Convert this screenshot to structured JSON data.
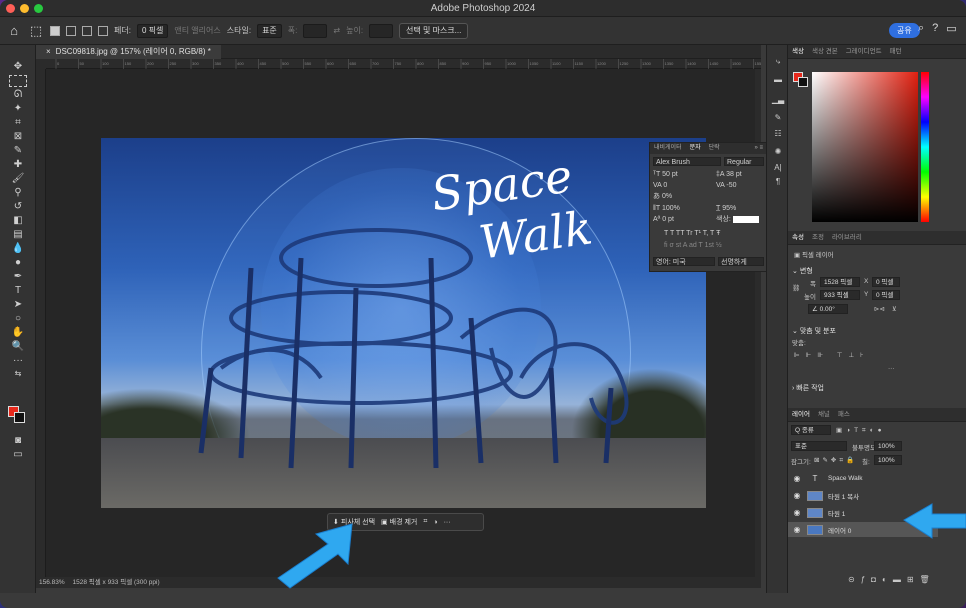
{
  "app": {
    "title": "Adobe Photoshop 2024",
    "share_label": "공유"
  },
  "options_bar": {
    "feather_label": "페더:",
    "feather_value": "0 픽셀",
    "antialias_label": "앤티 앨리어스",
    "style_label": "스타일:",
    "style_value": "표준",
    "width_label": "폭:",
    "height_label": "높이:",
    "select_mask_label": "선택 및 마스크..."
  },
  "document": {
    "tab_title": "DSC09818.jpg @ 157% (레이어 0, RGB/8) *",
    "zoom": "156.83%",
    "status_info": "1528 픽셀 x 933 픽셀 (300 ppi)",
    "ruler_ticks": [
      "0",
      "50",
      "100",
      "150",
      "200",
      "250",
      "300",
      "350",
      "400",
      "450",
      "500",
      "550",
      "600",
      "650",
      "700",
      "750",
      "800",
      "850",
      "900",
      "950",
      "1000",
      "1050",
      "1100",
      "1150",
      "1200",
      "1250",
      "1300",
      "1350",
      "1400",
      "1450",
      "1500",
      "1550"
    ]
  },
  "artwork": {
    "line1": "Space",
    "line2": "Walk"
  },
  "context_bar": {
    "select_subject": "피사체 선택",
    "remove_bg": "배경 제거",
    "more": "···"
  },
  "character_panel": {
    "tabs": [
      "내비게이터",
      "문자",
      "단락"
    ],
    "active_tab": "문자",
    "font_family": "Alex Brush",
    "font_style": "Regular",
    "font_size": "50 pt",
    "leading": "38 pt",
    "kerning": "0",
    "tracking": "-50",
    "tsume": "0%",
    "vertical_scale": "100%",
    "horizontal_scale": "95%",
    "baseline": "0 pt",
    "color_label": "색상:",
    "language": "영어: 미국",
    "antialias": "선명하게",
    "type_buttons": "T  T  TT  Tr  T¹  T,  T  Ŧ",
    "ot_buttons": "fi  σ  st  A  ad  T  1st  ½"
  },
  "color_panel": {
    "tabs": [
      "색상",
      "색상 견본",
      "그레이디언트",
      "패턴"
    ],
    "active_tab": "색상",
    "fg_color": "#e8291c"
  },
  "properties_panel": {
    "tabs": [
      "속성",
      "조정",
      "라이브러리"
    ],
    "active_tab": "속성",
    "layer_kind": "픽셀 레이어",
    "transform_title": "변형",
    "w_label": "폭",
    "w_value": "1528 픽셀",
    "x_label": "X",
    "x_value": "0 픽셀",
    "h_label": "높이",
    "h_value": "933 픽셀",
    "y_label": "Y",
    "y_value": "0 픽셀",
    "angle": "0.00°",
    "align_title": "맞춤 및 분포",
    "align_label": "맞춤:",
    "quick_actions": "빠른 작업"
  },
  "layers_panel": {
    "tabs": [
      "레이어",
      "채널",
      "패스"
    ],
    "active_tab": "레이어",
    "filter_label": "Q 종류",
    "blend_mode": "표준",
    "opacity_label": "불투명도:",
    "opacity": "100%",
    "lock_label": "잠그기:",
    "fill_label": "칠:",
    "fill": "100%",
    "layers": [
      {
        "name": "Space      Walk",
        "type": "text",
        "selected": false
      },
      {
        "name": "타원 1 복사",
        "type": "shape",
        "selected": false
      },
      {
        "name": "타원 1",
        "type": "shape",
        "selected": false
      },
      {
        "name": "레이어 0",
        "type": "pixel",
        "selected": true
      }
    ]
  }
}
